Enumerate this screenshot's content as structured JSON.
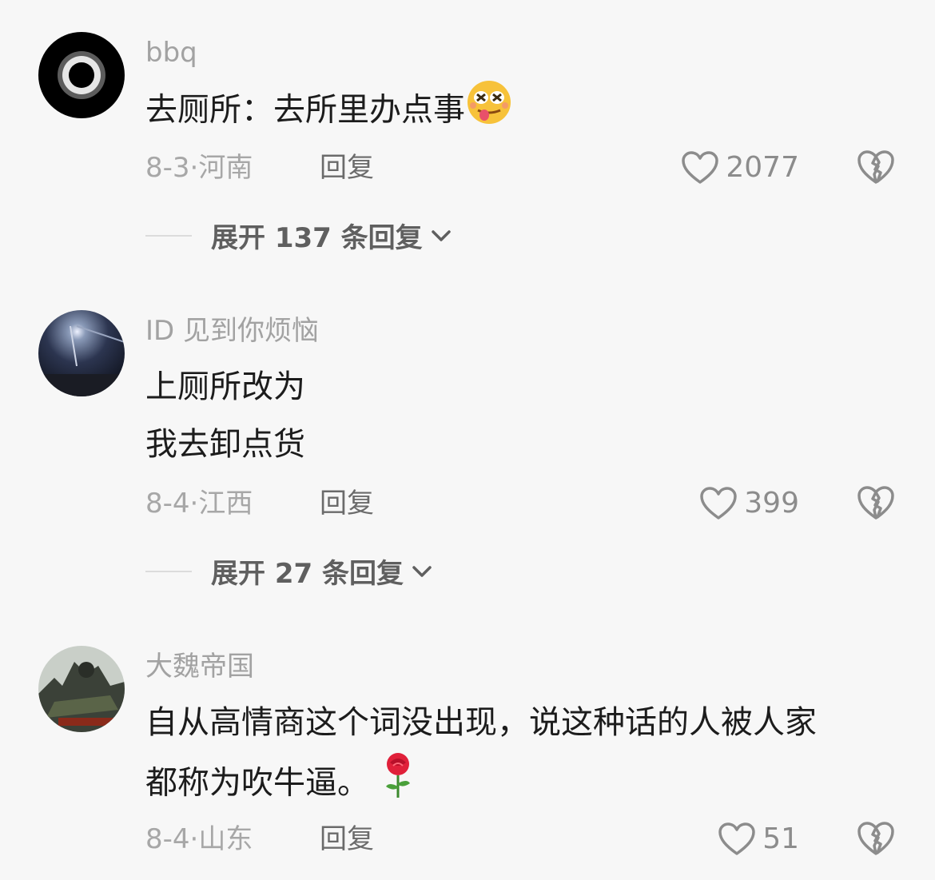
{
  "comments": [
    {
      "username": "bbq",
      "text": "去厕所：去所里办点事",
      "date": "8-3",
      "location": "河南",
      "reply_label": "回复",
      "likes": "2077",
      "expand_label": "展开 137 条回复"
    },
    {
      "username": "ID 见到你烦恼",
      "text_line1": "上厕所改为",
      "text_line2": "我去卸点货",
      "date": "8-4",
      "location": "江西",
      "reply_label": "回复",
      "likes": "399",
      "expand_label": "展开 27 条回复"
    },
    {
      "username": "大魏帝国",
      "text_line1": "自从高情商这个词没出现，说这种话的人被人家",
      "text_line2": "都称为吹牛逼。",
      "date": "8-4",
      "location": "山东",
      "reply_label": "回复",
      "likes": "51"
    }
  ],
  "meta_separator": "·",
  "icons": {
    "like": "heart-outline-icon",
    "dislike": "broken-heart-icon",
    "expand": "chevron-down-icon",
    "emoji_1": "drunk-tongue-emoji",
    "emoji_3": "rose-emoji"
  },
  "colors": {
    "background": "#f7f7f7",
    "text": "#1c1c1c",
    "muted": "#a7a7a7"
  }
}
